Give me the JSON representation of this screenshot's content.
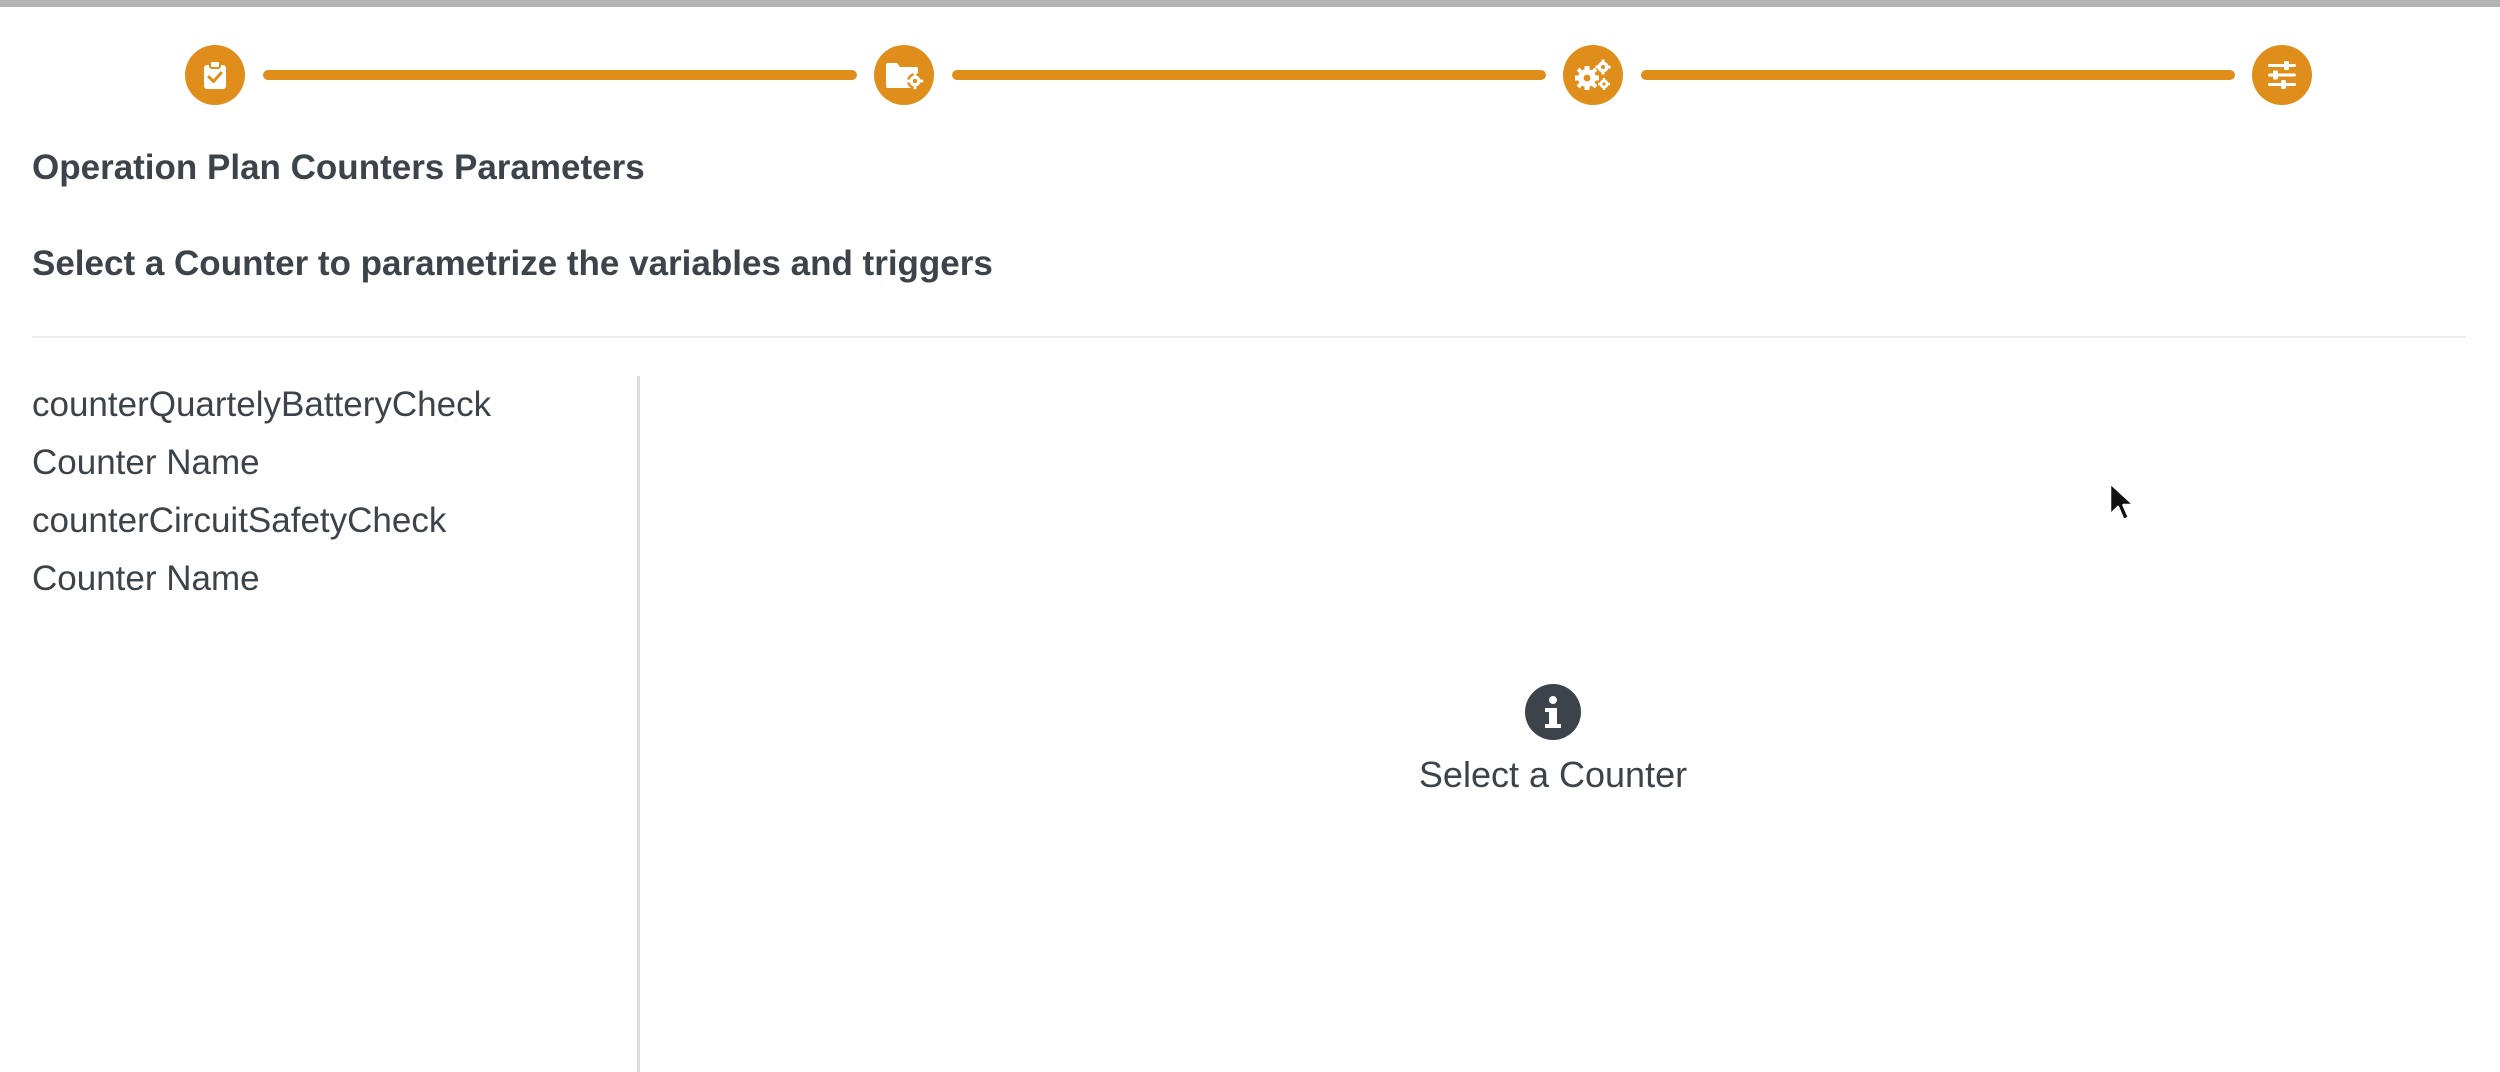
{
  "wizard": {
    "steps": [
      {
        "icon": "clipboard-check-icon",
        "state": "completed"
      },
      {
        "icon": "folder-gear-icon",
        "state": "completed"
      },
      {
        "icon": "gears-icon",
        "state": "completed"
      },
      {
        "icon": "sliders-icon",
        "state": "active"
      }
    ],
    "accent_color": "#e08e1b"
  },
  "page": {
    "title": "Operation Plan Counters Parameters",
    "subtitle": "Select a Counter to parametrize the variables and triggers"
  },
  "counters": {
    "items": [
      {
        "label": "counterQuartelyBatteryCheck"
      },
      {
        "label": "Counter Name"
      },
      {
        "label": "counterCircuitSafetyCheck"
      },
      {
        "label": "Counter Name"
      }
    ]
  },
  "detail": {
    "empty_icon": "info-circle-icon",
    "empty_text": "Select a Counter"
  },
  "colors": {
    "text": "#3d434a",
    "divider": "#ececec",
    "top_border": "#b3b3b3"
  }
}
